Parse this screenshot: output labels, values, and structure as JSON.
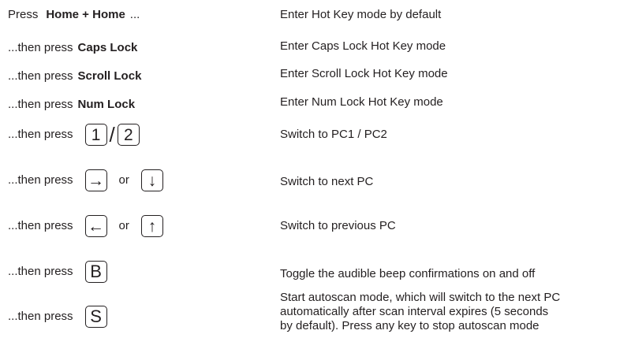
{
  "rows": [
    {
      "left_prefix": "Press",
      "left_key": "Home + Home",
      "left_suffix": "...",
      "description": "Enter Hot Key mode by default"
    },
    {
      "left_prefix": "...then press",
      "left_key": "Caps Lock",
      "description": "Enter Caps Lock  Hot Key mode"
    },
    {
      "left_prefix": "...then press",
      "left_key": "Scroll Lock",
      "description": "Enter Scroll Lock  Hot Key mode"
    },
    {
      "left_prefix": "...then press",
      "left_key": "Num Lock",
      "description": "Enter Num Lock  Hot Key mode"
    },
    {
      "left_prefix": "...then press",
      "keycap_1": "1",
      "separator": "/",
      "keycap_2": "2",
      "description": "Switch to PC1 / PC2"
    },
    {
      "left_prefix": "...then press",
      "keycap_1": "→",
      "separator": "or",
      "keycap_2": "↓",
      "description": "Switch to next PC"
    },
    {
      "left_prefix": "...then press",
      "keycap_1": "←",
      "separator": "or",
      "keycap_2": "↑",
      "description": "Switch to previous PC"
    },
    {
      "left_prefix": "...then press",
      "keycap_1": "B",
      "description": "Toggle the audible beep confirmations on and off"
    },
    {
      "left_prefix": "...then press",
      "keycap_1": "S",
      "description_lines": [
        "Start autoscan mode, which will switch to the next PC",
        "automatically after scan interval expires (5 seconds",
        "by default). Press any key to stop autoscan mode"
      ]
    }
  ]
}
